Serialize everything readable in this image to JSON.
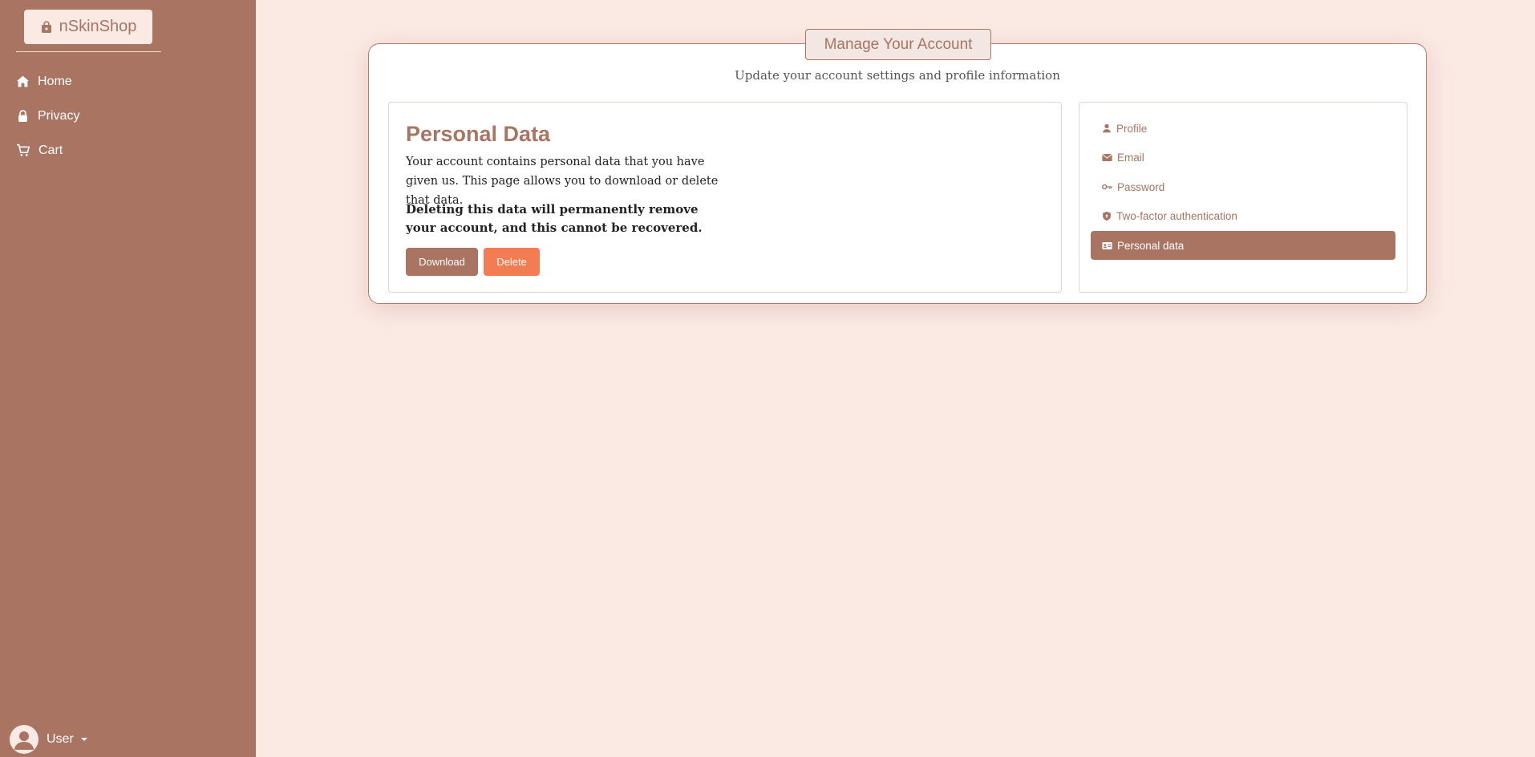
{
  "brand": {
    "name": "nSkinShop",
    "icon": "shopping-bag-icon"
  },
  "nav": {
    "items": [
      {
        "label": "Home",
        "icon": "house-icon"
      },
      {
        "label": "Privacy",
        "icon": "lock-icon"
      },
      {
        "label": "Cart",
        "icon": "cart-icon"
      }
    ]
  },
  "user": {
    "label": "User",
    "icon": "user-circle-icon"
  },
  "account": {
    "title": "Manage Your Account",
    "subtitle": "Update your account settings and profile information"
  },
  "personal_data": {
    "title": "Personal Data",
    "description": "Your account contains personal data that you have given us. This page allows you to download or delete that data.",
    "warning": "Deleting this data will permanently remove your account, and this cannot be recovered.",
    "download_label": "Download",
    "delete_label": "Delete"
  },
  "menu": {
    "items": [
      {
        "label": "Profile",
        "icon": "person-icon"
      },
      {
        "label": "Email",
        "icon": "envelope-icon"
      },
      {
        "label": "Password",
        "icon": "key-icon"
      },
      {
        "label": "Two-factor authentication",
        "icon": "shield-icon"
      },
      {
        "label": "Personal data",
        "icon": "id-card-icon",
        "active": true
      }
    ]
  },
  "colors": {
    "sidebar": "#a97462",
    "background": "#fbeae4",
    "accent": "#a97462",
    "danger": "#f47c52"
  }
}
